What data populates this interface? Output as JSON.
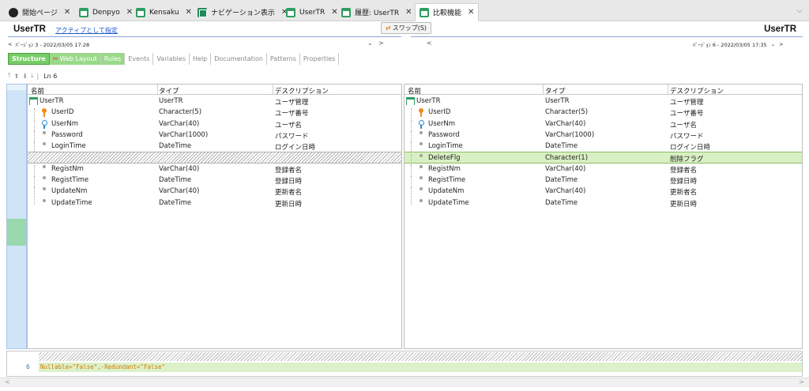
{
  "tabs": [
    {
      "label": "開始ページ",
      "icon": "globe-icon"
    },
    {
      "label": "Denpyo",
      "icon": "table-icon"
    },
    {
      "label": "Kensaku",
      "icon": "table-icon"
    },
    {
      "label": "ナビゲーション表示",
      "icon": "table-icon"
    },
    {
      "label": "UserTR",
      "icon": "table-icon"
    },
    {
      "label": "履歴: UserTR",
      "icon": "table-icon"
    },
    {
      "label": "比較機能",
      "icon": "table-icon",
      "active": true
    }
  ],
  "tab_close": "✕",
  "header": {
    "left_title": "UserTR",
    "make_active_link": "アクティブとして指定",
    "swap_label": "スワップ(S)",
    "right_title": "UserTR",
    "left_version": "ﾊﾞｰｼﾞｮﾝ 3 - 2022/03/05 17:28",
    "right_version": "ﾊﾞｰｼﾞｮﾝ 6 - 2022/03/05 17:35"
  },
  "view_tabs": [
    "Structure",
    "Web Layout",
    "Rules",
    "Events",
    "Variables",
    "Help",
    "Documentation",
    "Patterns",
    "Properties"
  ],
  "toolbar": {
    "line": "Ln 6"
  },
  "columns": {
    "name": "名前",
    "type": "タイプ",
    "description": "デスクリプション"
  },
  "left_rows": [
    {
      "name": "UserTR",
      "type": "UserTR",
      "desc": "ユーザ管理",
      "kind": "table"
    },
    {
      "name": "UserID",
      "type": "Character(5)",
      "desc": "ユーザ番号",
      "kind": "pk"
    },
    {
      "name": "UserNm",
      "type": "VarChar(40)",
      "desc": "ユーザ名",
      "kind": "desc"
    },
    {
      "name": "Password",
      "type": "VarChar(1000)",
      "desc": "パスワード",
      "kind": "attr"
    },
    {
      "name": "LoginTime",
      "type": "DateTime",
      "desc": "ログイン日時",
      "kind": "attr"
    },
    {
      "name": "",
      "type": "",
      "desc": "",
      "kind": "placeholder"
    },
    {
      "name": "RegistNm",
      "type": "VarChar(40)",
      "desc": "登録者名",
      "kind": "attr"
    },
    {
      "name": "RegistTime",
      "type": "DateTime",
      "desc": "登録日時",
      "kind": "attr"
    },
    {
      "name": "UpdateNm",
      "type": "VarChar(40)",
      "desc": "更新者名",
      "kind": "attr"
    },
    {
      "name": "UpdateTime",
      "type": "DateTime",
      "desc": "更新日時",
      "kind": "attr"
    }
  ],
  "right_rows": [
    {
      "name": "UserTR",
      "type": "UserTR",
      "desc": "ユーザ管理",
      "kind": "table"
    },
    {
      "name": "UserID",
      "type": "Character(5)",
      "desc": "ユーザ番号",
      "kind": "pk"
    },
    {
      "name": "UserNm",
      "type": "VarChar(40)",
      "desc": "ユーザ名",
      "kind": "desc"
    },
    {
      "name": "Password",
      "type": "VarChar(1000)",
      "desc": "パスワード",
      "kind": "attr"
    },
    {
      "name": "LoginTime",
      "type": "DateTime",
      "desc": "ログイン日時",
      "kind": "attr"
    },
    {
      "name": "DeleteFlg",
      "type": "Character(1)",
      "desc": "削除フラグ",
      "kind": "added"
    },
    {
      "name": "RegistNm",
      "type": "VarChar(40)",
      "desc": "登録者名",
      "kind": "attr"
    },
    {
      "name": "RegistTime",
      "type": "DateTime",
      "desc": "登録日時",
      "kind": "attr"
    },
    {
      "name": "UpdateNm",
      "type": "VarChar(40)",
      "desc": "更新者名",
      "kind": "attr"
    },
    {
      "name": "UpdateTime",
      "type": "DateTime",
      "desc": "更新日時",
      "kind": "attr"
    }
  ],
  "code": {
    "line_no": "6",
    "text": "Nullable=\"False\",·Redundant=\"False\""
  },
  "colors": {
    "added_row": "#d9efc4",
    "structure_tab": "#77cc66",
    "link": "#1a57c9"
  }
}
